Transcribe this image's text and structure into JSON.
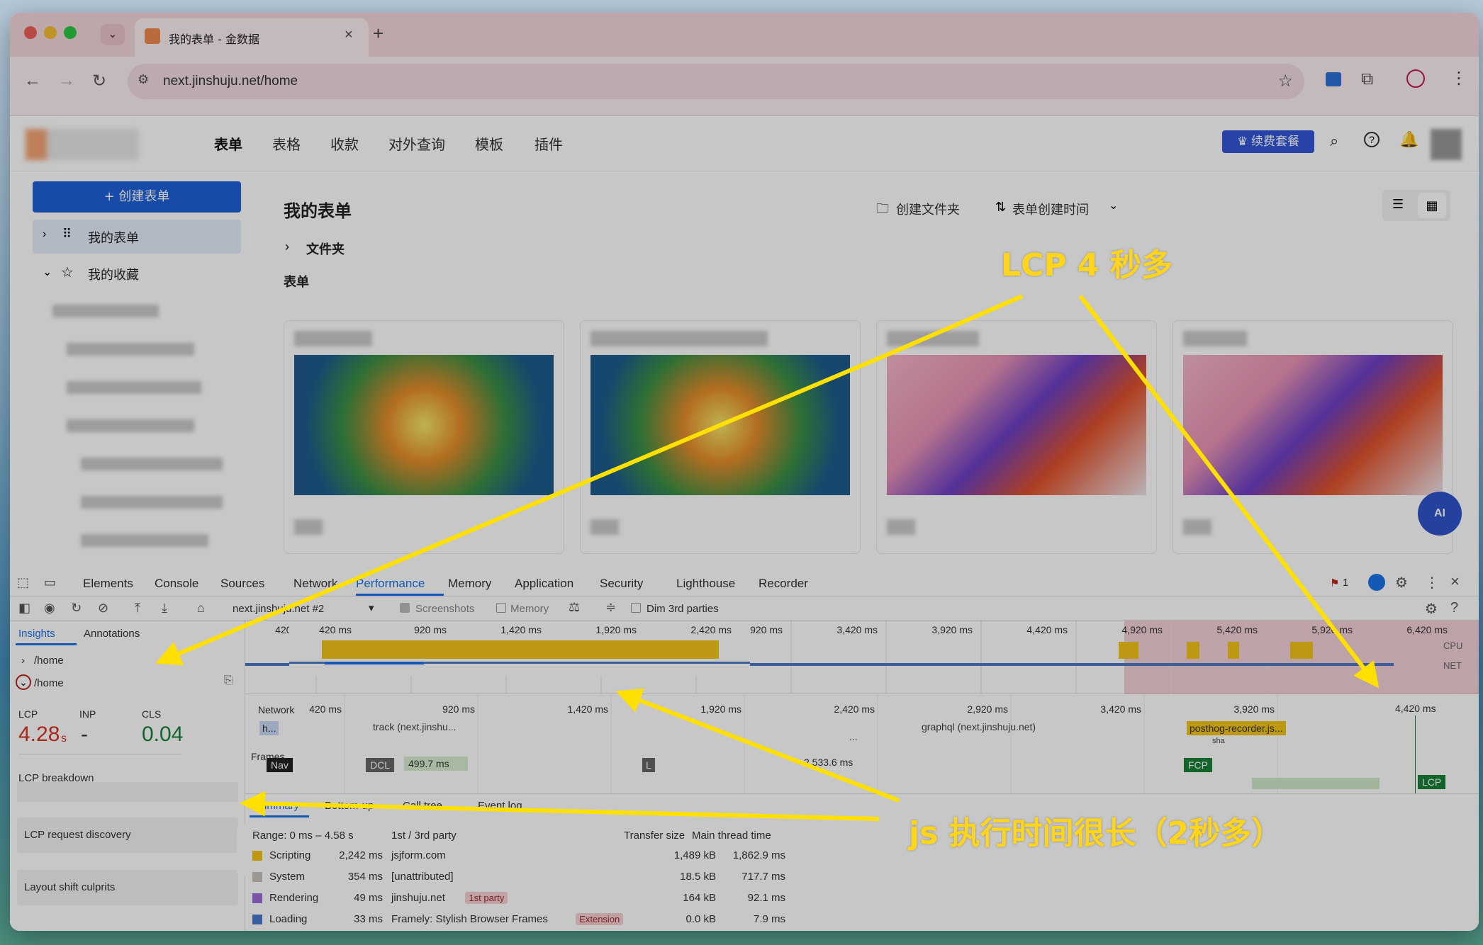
{
  "browser": {
    "tab_title": "我的表单 - 金数据",
    "url": "next.jinshuju.net/home"
  },
  "topnav": {
    "items": [
      "表单",
      "表格",
      "收款",
      "对外查询",
      "模板",
      "插件"
    ],
    "premium_label": "续费套餐"
  },
  "sidebar": {
    "create_button": "+ 创建表单",
    "my_forms": "我的表单",
    "my_favorites": "我的收藏"
  },
  "main": {
    "title": "我的表单",
    "create_folder": "创建文件夹",
    "sort_label": "表单创建时间",
    "folder_label": "文件夹",
    "forms_label": "表单",
    "ai_label": "AI"
  },
  "devtools": {
    "tabs": [
      "Elements",
      "Console",
      "Sources",
      "Network",
      "Performance",
      "Memory",
      "Application",
      "Security",
      "Lighthouse",
      "Recorder"
    ],
    "active_tab": "Performance",
    "issues_count": "1",
    "recording_name": "next.jinshuju.net #2",
    "screenshots_label": "Screenshots",
    "memory_label": "Memory",
    "dim_label": "Dim 3rd parties",
    "side_tabs": [
      "Insights",
      "Annotations"
    ],
    "route_label": "/home",
    "route_label2": "/home",
    "metrics": {
      "lcp_label": "LCP",
      "lcp_value": "4.28",
      "lcp_unit": "s",
      "inp_label": "INP",
      "inp_value": "-",
      "cls_label": "CLS",
      "cls_value": "0.04"
    },
    "insights": [
      "LCP breakdown",
      "LCP request discovery",
      "Layout shift culprits"
    ],
    "overview_ticks": [
      "420 ms",
      "920 ms",
      "1,420 ms",
      "1,920 ms",
      "2,420 ms",
      "2,920 ms",
      "3,420 ms",
      "3,920 ms",
      "4,420 ms",
      "4,920 ms",
      "5,420 ms",
      "5,920 ms",
      "6,420 ms"
    ],
    "overview_labels": {
      "cpu": "CPU",
      "net": "NET"
    },
    "timeline_ticks": [
      "420 ms",
      "920 ms",
      "1,420 ms",
      "1,920 ms",
      "2,420 ms",
      "2,920 ms",
      "3,420 ms",
      "3,920 ms",
      "4,420 ms"
    ],
    "network_label": "Network",
    "network_items": [
      "h...",
      "track (next.jinshu...",
      "graphql (next.jinshuju.net)",
      "posthog-recorder.js...",
      "sha"
    ],
    "frames_label": "Frames",
    "markers": {
      "nav": "Nav",
      "dcl": "DCL",
      "l": "L",
      "fcp": "FCP",
      "lcp": "LCP",
      "dcl_time": "499.7 ms",
      "l_time": "2,533.6 ms",
      "ellipsis": "..."
    },
    "bottom_tabs": [
      "Summary",
      "Bottom-up",
      "Call tree",
      "Event log"
    ],
    "summary": {
      "range": "Range: 0 ms – 4.58 s",
      "rows": [
        {
          "label": "Scripting",
          "value": "2,242 ms",
          "color": "#f2c318"
        },
        {
          "label": "System",
          "value": "354 ms",
          "color": "#c7c2bd"
        },
        {
          "label": "Rendering",
          "value": "49 ms",
          "color": "#9a6ed8"
        },
        {
          "label": "Loading",
          "value": "33 ms",
          "color": "#4b78c9"
        }
      ]
    },
    "third_party": {
      "headers": [
        "1st / 3rd party",
        "Transfer size",
        "Main thread time"
      ],
      "rows": [
        {
          "name": "jsjform.com",
          "tag": "",
          "size": "1,489 kB",
          "time": "1,862.9 ms"
        },
        {
          "name": "[unattributed]",
          "tag": "",
          "size": "18.5 kB",
          "time": "717.7 ms"
        },
        {
          "name": "jinshuju.net",
          "tag": "1st party",
          "size": "164 kB",
          "time": "92.1 ms"
        },
        {
          "name": "Framely: Stylish Browser Frames",
          "tag": "Extension",
          "size": "0.0 kB",
          "time": "7.9 ms"
        }
      ]
    }
  },
  "annotations": {
    "lcp": "LCP 4 秒多",
    "js": "js 执行时间很长（2秒多）"
  },
  "colors": {
    "accent": "#1f5fd6",
    "lcp_red": "#d93025",
    "cls_green": "#188038",
    "arrow": "#ffe000",
    "scripting": "#f2c318"
  }
}
